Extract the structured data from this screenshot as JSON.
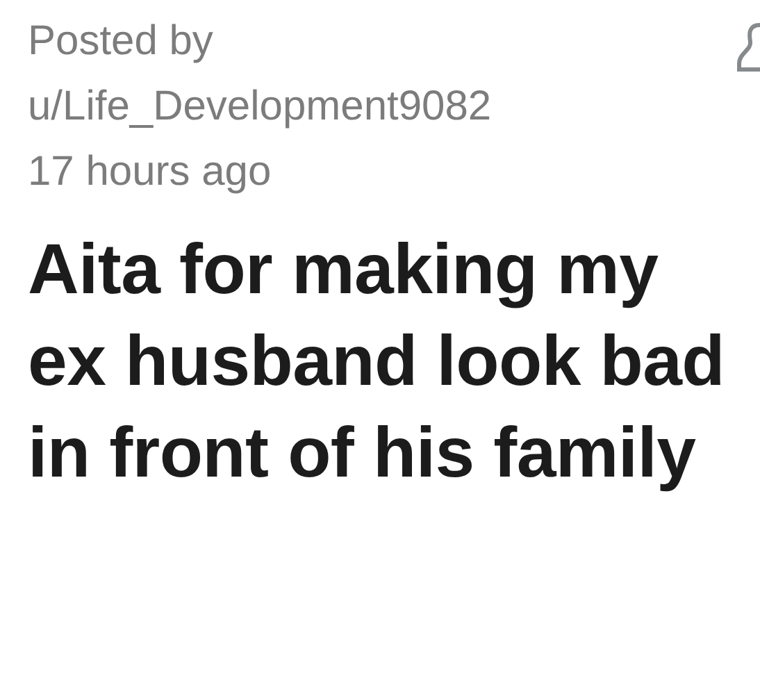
{
  "post": {
    "posted_by_label": "Posted by",
    "author": "u/Life_Development9082",
    "time": "17 hours ago",
    "title": "Aita for making my ex husband look bad in front of his family"
  }
}
